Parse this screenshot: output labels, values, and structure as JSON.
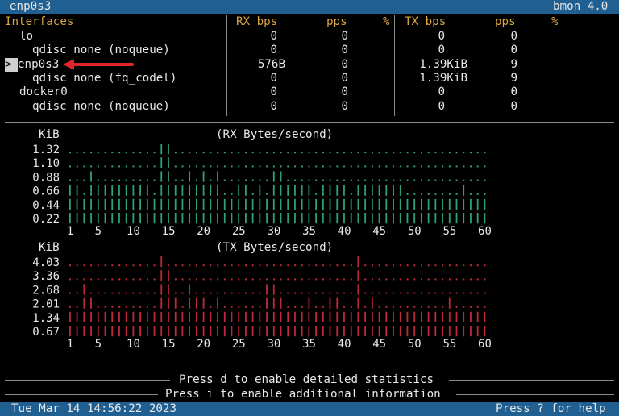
{
  "window": {
    "interface_title": "enp0s3",
    "app": "bmon 4.0"
  },
  "table": {
    "headers": {
      "name": "Interfaces",
      "rx_bps": "RX bps",
      "rx_pps": "pps",
      "rx_pct": "%",
      "tx_bps": "TX bps",
      "tx_pps": "pps",
      "tx_pct": "%"
    },
    "rows": [
      {
        "name": "lo",
        "indent": 1,
        "rx_bps": "0",
        "rx_pps": "0",
        "tx_bps": "0",
        "tx_pps": "0",
        "selected": false
      },
      {
        "name": "qdisc none (noqueue)",
        "indent": 3,
        "rx_bps": "0",
        "rx_pps": "0",
        "tx_bps": "0",
        "tx_pps": "0",
        "selected": false
      },
      {
        "name": "enp0s3",
        "indent": 1,
        "rx_bps": "576B",
        "rx_pps": "0",
        "tx_bps": "1.39KiB",
        "tx_pps": "9",
        "selected": true
      },
      {
        "name": "qdisc none (fq_codel)",
        "indent": 3,
        "rx_bps": "0",
        "rx_pps": "0",
        "tx_bps": "1.39KiB",
        "tx_pps": "9",
        "selected": false
      },
      {
        "name": "docker0",
        "indent": 1,
        "rx_bps": "0",
        "rx_pps": "0",
        "tx_bps": "0",
        "tx_pps": "0",
        "selected": false
      },
      {
        "name": "qdisc none (noqueue)",
        "indent": 3,
        "rx_bps": "0",
        "rx_pps": "0",
        "tx_bps": "0",
        "tx_pps": "0",
        "selected": false
      }
    ],
    "cursor_glyph": ">"
  },
  "chart_data": [
    {
      "type": "bar",
      "title": "(RX Bytes/second)",
      "ylabel": "KiB",
      "y_ticks": [
        "1.32",
        "1.10",
        "0.88",
        "0.66",
        "0.44",
        "0.22"
      ],
      "x_ticks": [
        "1",
        "5",
        "10",
        "15",
        "20",
        "25",
        "30",
        "35",
        "40",
        "45",
        "50",
        "55",
        "60"
      ],
      "color": "#2fa07a",
      "values": [
        0.66,
        0.66,
        0.44,
        0.88,
        0.66,
        0.66,
        0.66,
        0.66,
        0.66,
        0.66,
        0.66,
        0.66,
        0.44,
        1.32,
        1.32,
        0.66,
        0.66,
        0.88,
        0.66,
        0.88,
        0.66,
        0.88,
        0.44,
        0.44,
        0.66,
        0.66,
        0.44,
        0.66,
        0.44,
        0.88,
        0.88,
        0.66,
        0.66,
        0.66,
        0.66,
        0.44,
        0.66,
        0.66,
        0.66,
        0.66,
        0.44,
        0.66,
        0.66,
        0.66,
        0.66,
        0.66,
        0.66,
        0.66,
        0.44,
        0.44,
        0.44,
        0.44,
        0.44,
        0.44,
        0.44,
        0.44,
        0.66,
        0.44,
        0.44,
        0.44
      ]
    },
    {
      "type": "bar",
      "title": "(TX Bytes/second)",
      "ylabel": "KiB",
      "y_ticks": [
        "4.03",
        "3.36",
        "2.68",
        "2.01",
        "1.34",
        "0.67"
      ],
      "x_ticks": [
        "1",
        "5",
        "10",
        "15",
        "20",
        "25",
        "30",
        "35",
        "40",
        "45",
        "50",
        "55",
        "60"
      ],
      "color": "#c0283a",
      "values": [
        1.34,
        1.34,
        2.68,
        2.01,
        1.34,
        1.34,
        1.34,
        1.34,
        1.34,
        1.34,
        1.34,
        1.34,
        1.34,
        4.03,
        3.36,
        2.01,
        1.34,
        2.68,
        2.01,
        2.01,
        1.34,
        2.01,
        1.34,
        1.34,
        1.34,
        1.34,
        1.34,
        1.34,
        2.68,
        2.68,
        2.01,
        1.34,
        1.34,
        1.34,
        2.01,
        1.34,
        1.34,
        2.01,
        2.01,
        1.34,
        1.34,
        4.03,
        1.34,
        2.01,
        1.34,
        1.34,
        1.34,
        1.34,
        1.34,
        1.34,
        1.34,
        1.34,
        1.34,
        1.34,
        2.01,
        1.34,
        1.34,
        1.34,
        1.34,
        1.34
      ]
    }
  ],
  "footer": {
    "hint_detailed": "Press d to enable detailed statistics",
    "hint_info": "Press i to enable additional information",
    "datetime": "Tue Mar 14 14:56:22 2023",
    "help": "Press ? for help"
  },
  "colors": {
    "bar_bg": "#1f5f91",
    "header_gold": "#d9a441",
    "rx": "#2fa07a",
    "tx": "#c0283a"
  }
}
